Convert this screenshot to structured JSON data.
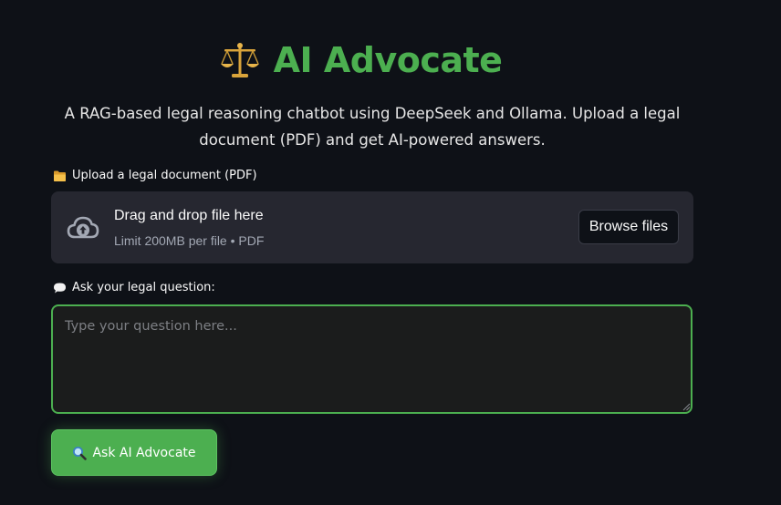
{
  "header": {
    "icon": "balance-scale-icon",
    "title": "AI Advocate",
    "subtitle": "A RAG-based legal reasoning chatbot using DeepSeek and Ollama. Upload a legal document (PDF) and get AI-powered answers."
  },
  "upload": {
    "label_icon": "folder-icon",
    "label": "Upload a legal document (PDF)",
    "dropzone_icon": "cloud-upload-icon",
    "drop_text": "Drag and drop file here",
    "limit_text": "Limit 200MB per file • PDF",
    "browse_label": "Browse files"
  },
  "question": {
    "label_icon": "speech-bubble-icon",
    "label": "Ask your legal question:",
    "placeholder": "Type your question here...",
    "value": ""
  },
  "ask_button": {
    "icon": "magnifier-icon",
    "label": "Ask AI Advocate"
  },
  "colors": {
    "background": "#0e1117",
    "accent": "#4caf50",
    "dropzone": "#262730",
    "textarea": "#1b1c1c"
  }
}
